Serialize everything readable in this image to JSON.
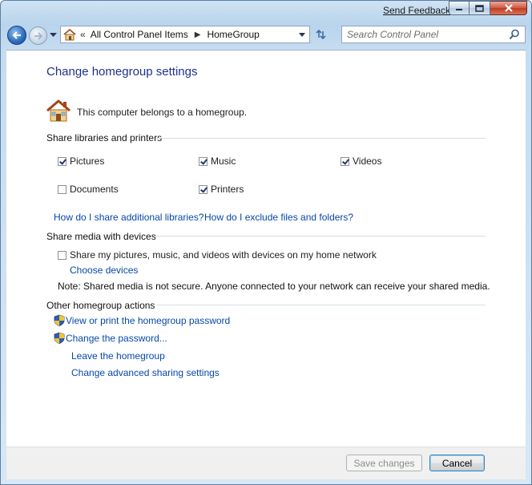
{
  "window": {
    "send_feedback": "Send Feedback",
    "colors": {
      "link": "#0648a8",
      "title": "#1e3287",
      "chrome": "#c6dcf0"
    }
  },
  "nav": {
    "breadcrumb_overflow": "«",
    "breadcrumb": [
      "All Control Panel Items",
      "HomeGroup"
    ],
    "search_placeholder": "Search Control Panel",
    "icons": [
      "back-icon",
      "forward-icon",
      "recent-pages-icon",
      "homegroup-icon",
      "refresh-icon",
      "search-icon"
    ]
  },
  "page": {
    "title": "Change homegroup settings",
    "status": "This computer belongs to a homegroup.",
    "share_libraries": {
      "heading": "Share libraries and printers",
      "items": [
        {
          "label": "Pictures",
          "checked": true
        },
        {
          "label": "Music",
          "checked": true
        },
        {
          "label": "Videos",
          "checked": true
        },
        {
          "label": "Documents",
          "checked": false
        },
        {
          "label": "Printers",
          "checked": true
        }
      ],
      "link_libraries": "How do I share additional libraries?",
      "link_exclude": "How do I exclude files and folders?"
    },
    "share_media": {
      "heading": "Share media with devices",
      "checkbox_label": "Share my pictures, music, and videos with devices on my home network",
      "checked": false,
      "choose_devices": "Choose devices",
      "note": "Note: Shared media is not secure. Anyone connected to your network can receive your shared media."
    },
    "other_actions": {
      "heading": "Other homegroup actions",
      "view_password": "View or print the homegroup password",
      "change_password": "Change the password...",
      "leave": "Leave the homegroup",
      "advanced": "Change advanced sharing settings"
    }
  },
  "footer": {
    "save": "Save changes",
    "cancel": "Cancel"
  }
}
